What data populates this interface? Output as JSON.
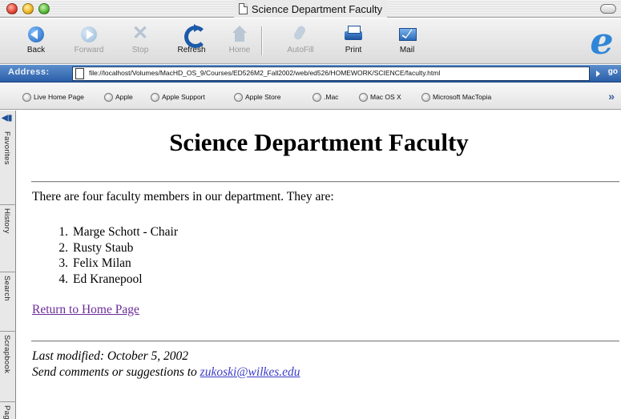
{
  "window": {
    "title": "Science Department Faculty"
  },
  "toolbar": {
    "buttons": [
      {
        "label": "Back",
        "icon": "back-arrow-icon",
        "enabled": true
      },
      {
        "label": "Forward",
        "icon": "forward-arrow-icon",
        "enabled": false
      },
      {
        "label": "Stop",
        "icon": "stop-x-icon",
        "enabled": false
      },
      {
        "label": "Refresh",
        "icon": "refresh-icon",
        "enabled": true
      },
      {
        "label": "Home",
        "icon": "home-icon",
        "enabled": false
      },
      {
        "label": "AutoFill",
        "icon": "autofill-icon",
        "enabled": false
      },
      {
        "label": "Print",
        "icon": "printer-icon",
        "enabled": true
      },
      {
        "label": "Mail",
        "icon": "mail-icon",
        "enabled": true
      }
    ],
    "logo": "e"
  },
  "address": {
    "label": "Address:",
    "url": "file://localhost/Volumes/MacHD_OS_9/Courses/ED526M2_Fall2002/web/ed526/HOMEWORK/SCIENCE/faculty.html",
    "go_label": "go"
  },
  "favorites": {
    "items": [
      "Live Home Page",
      "Apple",
      "Apple Support",
      "Apple Store",
      ".Mac",
      "Mac OS X",
      "Microsoft MacTopia"
    ],
    "more": "»"
  },
  "sidebar": {
    "tabs": [
      "Favorites",
      "History",
      "Search",
      "Scrapbook",
      "Pag"
    ]
  },
  "page": {
    "heading": "Science Department Faculty",
    "intro": "There are four faculty members in our department. They are:",
    "faculty": [
      {
        "num": "1.",
        "name": "Marge Schott - Chair"
      },
      {
        "num": "2.",
        "name": "Rusty Staub"
      },
      {
        "num": "3.",
        "name": "Felix Milan"
      },
      {
        "num": "4.",
        "name": "Ed Kranepool"
      }
    ],
    "home_link": "Return to Home Page",
    "last_modified": "Last modified: October 5, 2002",
    "comments_prefix": "Send comments or suggestions to ",
    "email": "zukoski@wilkes.edu"
  },
  "colors": {
    "address_bar": "#2a5ea8",
    "visited_link": "#6b2b9a",
    "link": "#3b3bc9",
    "ie_logo": "#2f86d8"
  }
}
